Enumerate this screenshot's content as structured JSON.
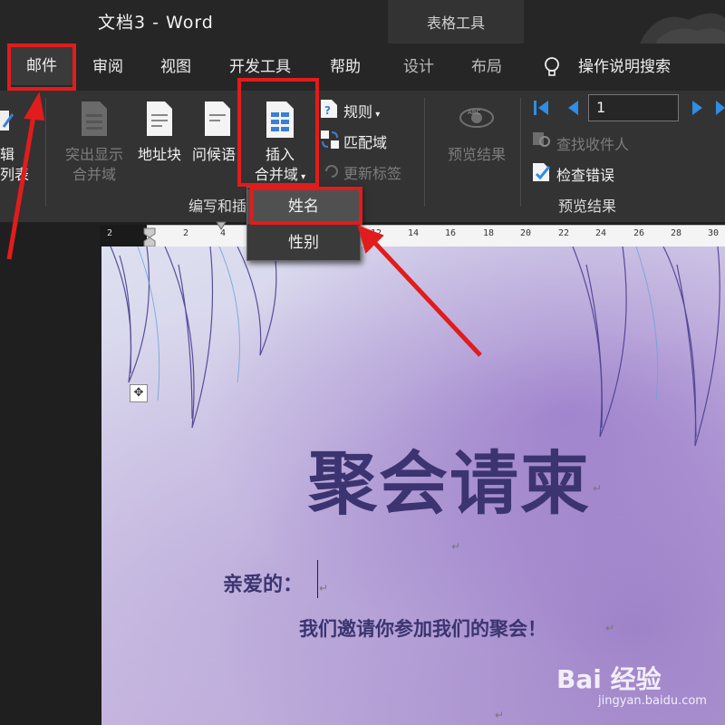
{
  "window": {
    "title": "文档3  -  Word",
    "context_tab_header": "表格工具"
  },
  "tabs": [
    {
      "label": "邮件",
      "selected": true
    },
    {
      "label": "审阅"
    },
    {
      "label": "视图"
    },
    {
      "label": "开发工具"
    },
    {
      "label": "帮助"
    },
    {
      "label": "设计"
    },
    {
      "label": "布局"
    }
  ],
  "tell_me": "操作说明搜索",
  "ribbon": {
    "partial_left": {
      "line1": "辑",
      "line2": "列表"
    },
    "write_insert": {
      "highlight_merge_fields": {
        "line1": "突出显示",
        "line2": "合并域"
      },
      "address_block": "地址块",
      "greeting_line": "问候语",
      "insert_merge_field": {
        "line1": "插入",
        "line2": "合并域"
      },
      "rules": "规则",
      "match_fields": "匹配域",
      "update_labels": "更新标签",
      "group_label": "编写和插"
    },
    "preview": {
      "preview_results": "预览结果",
      "record_number": "1",
      "find_recipient": "查找收件人",
      "check_errors": "检查错误",
      "group_label": "预览结果"
    }
  },
  "dropdown": {
    "items": [
      "姓名",
      "性别"
    ]
  },
  "ruler": {
    "ticks": [
      "2",
      "2",
      "4",
      "12",
      "14",
      "16",
      "18",
      "20",
      "22",
      "24",
      "26",
      "28",
      "30"
    ]
  },
  "document": {
    "heading": "聚会请柬",
    "salutation": "亲爱的：",
    "invitation": "我们邀请你参加我们的聚会！",
    "move_handle": "✥",
    "para_mark": "↵"
  },
  "watermark": {
    "brand": "Bai 经验",
    "url": "jingyan.baidu.com"
  },
  "colors": {
    "annotation_red": "#e11c1c",
    "heading_purple": "#3b3470"
  }
}
